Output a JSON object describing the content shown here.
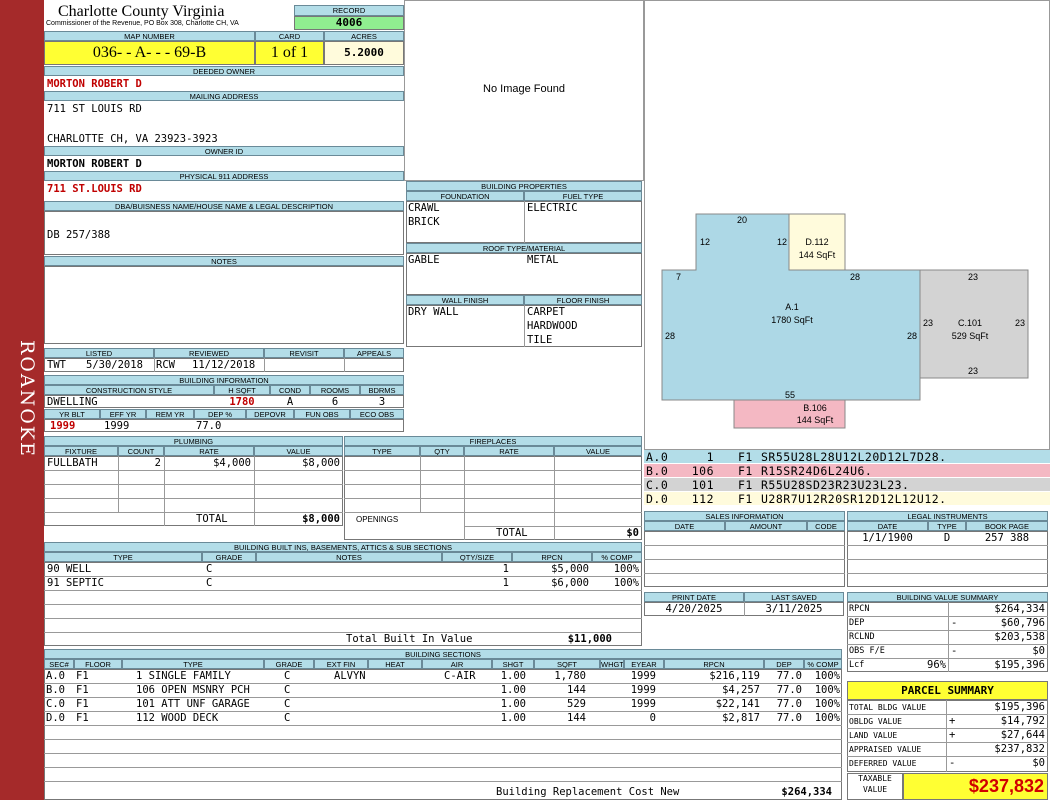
{
  "side_label": "ROANOKE",
  "county": "Charlotte County Virginia",
  "commissioner": "Commissioner of the Revenue, PO Box 308, Charlotte CH, VA",
  "record": {
    "label": "RECORD",
    "value": "4006"
  },
  "map": {
    "label": "MAP NUMBER",
    "value": "036- - A- - - 69-B"
  },
  "card": {
    "label": "CARD",
    "value": "1 of 1"
  },
  "acres": {
    "label": "ACRES",
    "value": "5.2000"
  },
  "deeded_owner": {
    "label": "DEEDED OWNER",
    "value": "MORTON ROBERT D"
  },
  "mailing": {
    "label": "MAILING ADDRESS",
    "line1": "711 ST LOUIS RD",
    "line2": "CHARLOTTE CH, VA 23923-3923"
  },
  "owner_id": {
    "label": "OWNER ID",
    "value": "MORTON ROBERT D"
  },
  "physical": {
    "label": "PHYSICAL 911 ADDRESS",
    "value": "711 ST.LOUIS RD"
  },
  "dba": {
    "label": "DBA/BUISNESS NAME/HOUSE NAME & LEGAL DESCRIPTION",
    "value": "DB 257/388"
  },
  "notes": {
    "label": "NOTES"
  },
  "image": {
    "text": "No Image Found"
  },
  "listing": {
    "listed_label": "LISTED",
    "reviewed_label": "REVIEWED",
    "revisit_label": "REVISIT",
    "appeals_label": "APPEALS",
    "listed_by": "TWT",
    "listed_date": "5/30/2018",
    "reviewed_by": "RCW",
    "reviewed_date": "11/12/2018"
  },
  "bldg_info": {
    "label": "BUILDING INFORMATION",
    "h_style": "CONSTRUCTION STYLE",
    "h_hsqft": "H SQFT",
    "h_cond": "COND",
    "h_rooms": "ROOMS",
    "h_bdrms": "BDRMS",
    "style": "DWELLING",
    "hsqft": "1780",
    "cond": "A",
    "rooms": "6",
    "bdrms": "3",
    "h_yrblt": "YR BLT",
    "h_effyr": "EFF YR",
    "h_remyr": "REM YR",
    "h_dep": "DEP %",
    "h_depovr": "DEPOVR",
    "h_funobs": "FUN OBS",
    "h_ecoobs": "ECO OBS",
    "yrblt": "1999",
    "effyr": "1999",
    "dep": "77.0"
  },
  "props": {
    "label": "BUILDING PROPERTIES",
    "foundation_label": "FOUNDATION",
    "fuel_label": "FUEL TYPE",
    "foundation1": "CRAWL",
    "foundation2": "BRICK",
    "fuel": "ELECTRIC",
    "roof_label": "ROOF TYPE/MATERIAL",
    "roof_type": "GABLE",
    "roof_mat": "METAL",
    "wall_label": "WALL FINISH",
    "floor_label": "FLOOR FINISH",
    "wall": "DRY WALL",
    "floor1": "CARPET",
    "floor2": "HARDWOOD",
    "floor3": "TILE"
  },
  "sketch": {
    "a_label": "A.1",
    "a_area": "1780 SqFt",
    "b_label": "B.106",
    "b_area": "144 SqFt",
    "c_label": "C.101",
    "c_area": "529 SqFt",
    "d_label": "D.112",
    "d_area": "144 SqFt",
    "dim_20": "20",
    "dim_12a": "12",
    "dim_12b": "12",
    "dim_7": "7",
    "dim_28a": "28",
    "dim_28b": "28",
    "dim_28c": "28",
    "dim_55": "55",
    "dim_23a": "23",
    "dim_23b": "23",
    "dim_23c": "23",
    "dim_23d": "23"
  },
  "vectors": [
    {
      "code": "A.0",
      "num": "1",
      "fl": "F1",
      "vec": "SR55U28L28U12L20D12L7D28.",
      "color": "#b3dde8"
    },
    {
      "code": "B.0",
      "num": "106",
      "fl": "F1",
      "vec": "R15SR24D6L24U6.",
      "color": "#f4b8c3"
    },
    {
      "code": "C.0",
      "num": "101",
      "fl": "F1",
      "vec": "R55U28SD23R23U23L23.",
      "color": "#d3d3d3"
    },
    {
      "code": "D.0",
      "num": "112",
      "fl": "F1",
      "vec": "U28R7U12R20SR12D12L12U12.",
      "color": "#fffbdc"
    }
  ],
  "plumbing": {
    "label": "PLUMBING",
    "h_fixture": "FIXTURE",
    "h_count": "COUNT",
    "h_rate": "RATE",
    "h_value": "VALUE",
    "fixture": "FULLBATH",
    "count": "2",
    "rate": "$4,000",
    "value": "$8,000",
    "total_label": "TOTAL",
    "total": "$8,000"
  },
  "fireplaces": {
    "label": "FIREPLACES",
    "h_type": "TYPE",
    "h_qty": "QTY",
    "h_rate": "RATE",
    "h_value": "VALUE",
    "openings": "OPENINGS",
    "total_label": "TOTAL",
    "total": "$0"
  },
  "builtins": {
    "label": "BUILDING BUILT INS, BASEMENTS, ATTICS & SUB SECTIONS",
    "h_type": "TYPE",
    "h_grade": "GRADE",
    "h_notes": "NOTES",
    "h_qty": "QTY/SIZE",
    "h_rpcn": "RPCN",
    "h_comp": "% COMP",
    "rows": [
      {
        "type": "90 WELL",
        "grade": "C",
        "qty": "1",
        "rpcn": "$5,000",
        "comp": "100%"
      },
      {
        "type": "91 SEPTIC",
        "grade": "C",
        "qty": "1",
        "rpcn": "$6,000",
        "comp": "100%"
      }
    ],
    "total_label": "Total Built In Value",
    "total": "$11,000"
  },
  "sales": {
    "label": "SALES INFORMATION",
    "h_date": "DATE",
    "h_amount": "AMOUNT",
    "h_code": "CODE"
  },
  "legal": {
    "label": "LEGAL INSTRUMENTS",
    "h_date": "DATE",
    "h_type": "TYPE",
    "h_book": "BOOK PAGE",
    "date": "1/1/1900",
    "type": "D",
    "book": "257 388"
  },
  "print": {
    "print_label": "PRINT DATE",
    "saved_label": "LAST SAVED",
    "print_date": "4/20/2025",
    "saved_date": "3/11/2025"
  },
  "value_summary": {
    "label": "BUILDING VALUE SUMMARY",
    "rpcn_l": "RPCN",
    "rpcn": "$264,334",
    "dep_l": "DEP",
    "dep_s": "-",
    "dep": "$60,796",
    "rclnd_l": "RCLND",
    "rclnd": "$203,538",
    "obs_l": "OBS F/E",
    "obs_s": "-",
    "obs": "$0",
    "lcf_l": "Lcf",
    "lcf_p": "96%",
    "lcf": "$195,396"
  },
  "parcel": {
    "title": "PARCEL SUMMARY",
    "tbv_l": "TOTAL BLDG VALUE",
    "tbv": "$195,396",
    "obv_l": "OBLDG VALUE",
    "obv_s": "+",
    "obv": "$14,792",
    "land_l": "LAND VALUE",
    "land_s": "+",
    "land": "$27,644",
    "appr_l": "APPRAISED VALUE",
    "appr": "$237,832",
    "def_l": "DEFERRED VALUE",
    "def_s": "-",
    "def": "$0",
    "tax_l1": "TAXABLE",
    "tax_l2": "VALUE",
    "tax": "$237,832"
  },
  "sections": {
    "label": "BUILDING SECTIONS",
    "h": [
      "SEC#",
      "FLOOR",
      "TYPE",
      "GRADE",
      "EXT FIN",
      "HEAT",
      "AIR",
      "SHGT",
      "SQFT",
      "WHGT",
      "EYEAR",
      "RPCN",
      "DEP",
      "% COMP"
    ],
    "rows": [
      {
        "sec": "A.0",
        "floor": "F1",
        "type": "1 SINGLE FAMILY",
        "grade": "C",
        "ext": "ALVYN",
        "heat": "",
        "air": "C-AIR",
        "shgt": "1.00",
        "sqft": "1,780",
        "whgt": "",
        "eyear": "1999",
        "rpcn": "$216,119",
        "dep": "77.0",
        "comp": "100%"
      },
      {
        "sec": "B.0",
        "floor": "F1",
        "type": "106 OPEN MSNRY PCH",
        "grade": "C",
        "ext": "",
        "heat": "",
        "air": "",
        "shgt": "1.00",
        "sqft": "144",
        "whgt": "",
        "eyear": "1999",
        "rpcn": "$4,257",
        "dep": "77.0",
        "comp": "100%"
      },
      {
        "sec": "C.0",
        "floor": "F1",
        "type": "101 ATT UNF GARAGE",
        "grade": "C",
        "ext": "",
        "heat": "",
        "air": "",
        "shgt": "1.00",
        "sqft": "529",
        "whgt": "",
        "eyear": "1999",
        "rpcn": "$22,141",
        "dep": "77.0",
        "comp": "100%"
      },
      {
        "sec": "D.0",
        "floor": "F1",
        "type": "112 WOOD DECK",
        "grade": "C",
        "ext": "",
        "heat": "",
        "air": "",
        "shgt": "1.00",
        "sqft": "144",
        "whgt": "",
        "eyear": "0",
        "rpcn": "$2,817",
        "dep": "77.0",
        "comp": "100%"
      }
    ],
    "total_label": "Building Replacement Cost New",
    "total": "$264,334"
  }
}
